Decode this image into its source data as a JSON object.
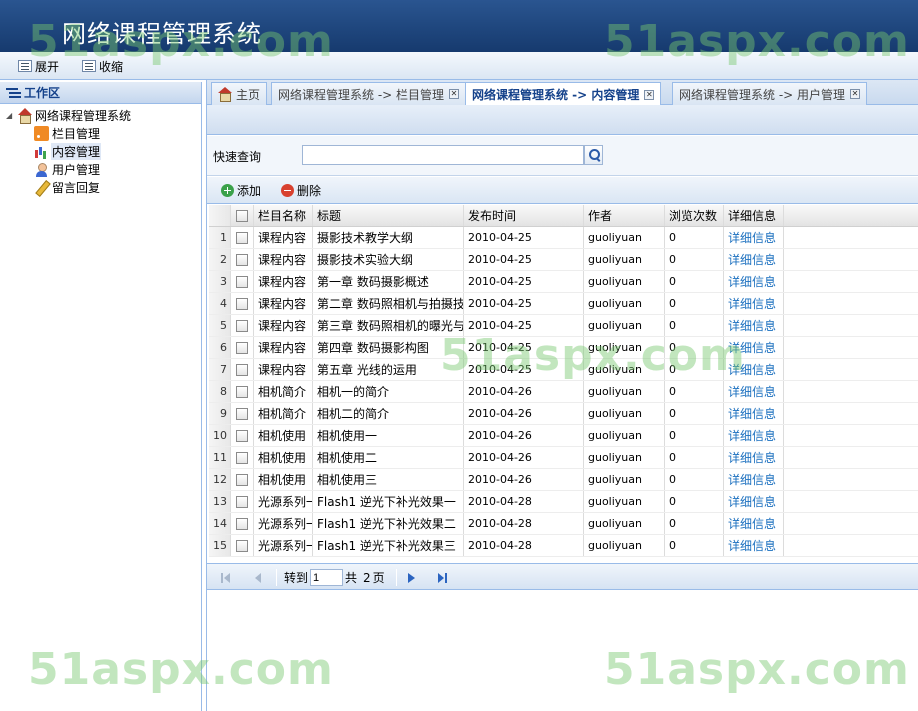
{
  "app": {
    "title": "网络课程管理系统"
  },
  "topbar": {
    "expand_label": "展开",
    "collapse_label": "收缩"
  },
  "sidebar": {
    "header": "工作区",
    "root": "网络课程管理系统",
    "items": [
      {
        "label": "栏目管理",
        "icon": "rss-icon"
      },
      {
        "label": "内容管理",
        "icon": "chart-icon",
        "selected": true
      },
      {
        "label": "用户管理",
        "icon": "user-icon"
      },
      {
        "label": "留言回复",
        "icon": "pen-icon"
      }
    ]
  },
  "tabs": [
    {
      "label": "主页"
    },
    {
      "label": "网络课程管理系统 -> 栏目管理"
    },
    {
      "label": "网络课程管理系统 -> 内容管理",
      "active": true
    },
    {
      "label": "网络课程管理系统 -> 用户管理"
    }
  ],
  "search": {
    "label": "快速查询",
    "value": ""
  },
  "grid_toolbar": {
    "add_label": "添加",
    "delete_label": "删除"
  },
  "grid": {
    "columns": [
      "栏目名称",
      "标题",
      "发布时间",
      "作者",
      "浏览次数",
      "详细信息"
    ],
    "rows": [
      {
        "n": "1",
        "cat": "课程内容",
        "title": "摄影技术教学大纲",
        "date": "2010-04-25",
        "author": "guoliyuan",
        "views": "0",
        "detail": "详细信息"
      },
      {
        "n": "2",
        "cat": "课程内容",
        "title": "摄影技术实验大纲",
        "date": "2010-04-25",
        "author": "guoliyuan",
        "views": "0",
        "detail": "详细信息"
      },
      {
        "n": "3",
        "cat": "课程内容",
        "title": "第一章 数码摄影概述",
        "date": "2010-04-25",
        "author": "guoliyuan",
        "views": "0",
        "detail": "详细信息"
      },
      {
        "n": "4",
        "cat": "课程内容",
        "title": "第二章 数码照相机与拍摄技",
        "date": "2010-04-25",
        "author": "guoliyuan",
        "views": "0",
        "detail": "详细信息"
      },
      {
        "n": "5",
        "cat": "课程内容",
        "title": "第三章 数码照相机的曝光与",
        "date": "2010-04-25",
        "author": "guoliyuan",
        "views": "0",
        "detail": "详细信息"
      },
      {
        "n": "6",
        "cat": "课程内容",
        "title": "第四章 数码摄影构图",
        "date": "2010-04-25",
        "author": "guoliyuan",
        "views": "0",
        "detail": "详细信息"
      },
      {
        "n": "7",
        "cat": "课程内容",
        "title": "第五章 光线的运用",
        "date": "2010-04-25",
        "author": "guoliyuan",
        "views": "0",
        "detail": "详细信息"
      },
      {
        "n": "8",
        "cat": "相机简介",
        "title": "相机一的简介",
        "date": "2010-04-26",
        "author": "guoliyuan",
        "views": "0",
        "detail": "详细信息"
      },
      {
        "n": "9",
        "cat": "相机简介",
        "title": "相机二的简介",
        "date": "2010-04-26",
        "author": "guoliyuan",
        "views": "0",
        "detail": "详细信息"
      },
      {
        "n": "10",
        "cat": "相机使用",
        "title": "相机使用一",
        "date": "2010-04-26",
        "author": "guoliyuan",
        "views": "0",
        "detail": "详细信息"
      },
      {
        "n": "11",
        "cat": "相机使用",
        "title": "相机使用二",
        "date": "2010-04-26",
        "author": "guoliyuan",
        "views": "0",
        "detail": "详细信息"
      },
      {
        "n": "12",
        "cat": "相机使用",
        "title": "相机使用三",
        "date": "2010-04-26",
        "author": "guoliyuan",
        "views": "0",
        "detail": "详细信息"
      },
      {
        "n": "13",
        "cat": "光源系列一",
        "title": "Flash1 逆光下补光效果一",
        "date": "2010-04-28",
        "author": "guoliyuan",
        "views": "0",
        "detail": "详细信息"
      },
      {
        "n": "14",
        "cat": "光源系列一",
        "title": "Flash1 逆光下补光效果二",
        "date": "2010-04-28",
        "author": "guoliyuan",
        "views": "0",
        "detail": "详细信息"
      },
      {
        "n": "15",
        "cat": "光源系列一",
        "title": "Flash1 逆光下补光效果三",
        "date": "2010-04-28",
        "author": "guoliyuan",
        "views": "0",
        "detail": "详细信息"
      }
    ]
  },
  "pager": {
    "goto_label": "转到",
    "page_value": "1",
    "total_prefix": "共",
    "total_pages": "2",
    "page_suffix": "页"
  },
  "watermark": "51aspx.com",
  "colors": {
    "header": "#1e4478",
    "accent": "#99bbe8",
    "link": "#1a6fbf",
    "watermark": "#78c86e"
  }
}
